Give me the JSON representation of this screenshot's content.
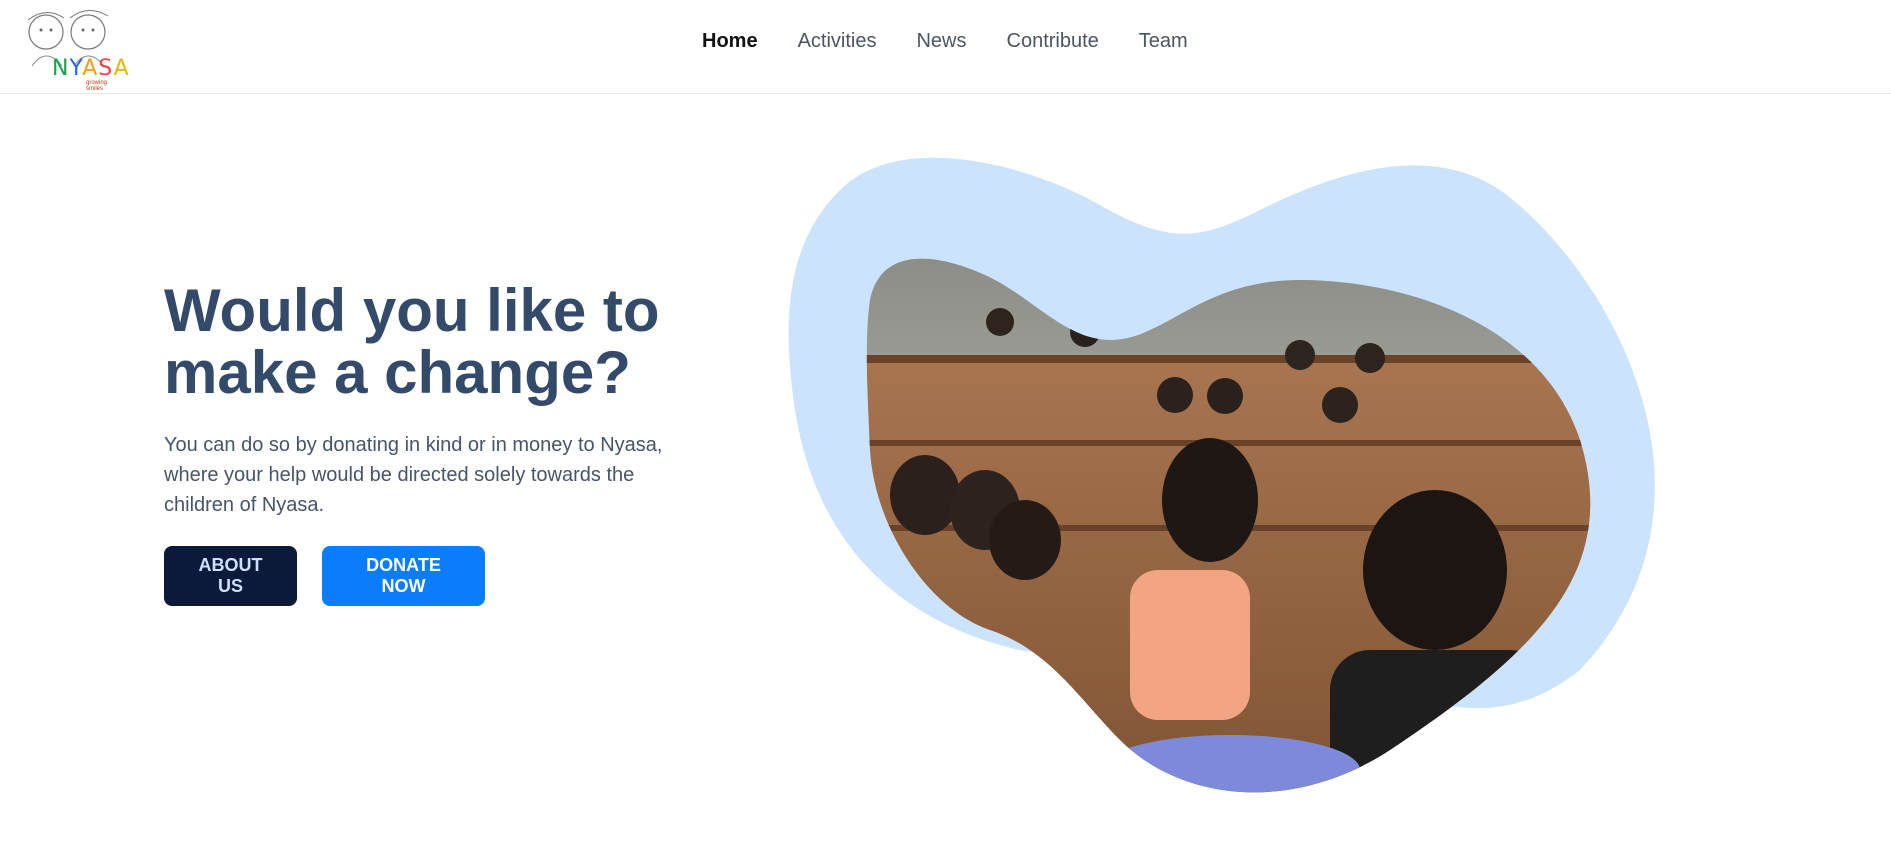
{
  "header": {
    "logo": {
      "letters": [
        "N",
        "Y",
        "A",
        "S",
        "A"
      ],
      "tagline": "growing smiles"
    },
    "nav": [
      {
        "label": "Home",
        "active": true
      },
      {
        "label": "Activities",
        "active": false
      },
      {
        "label": "News",
        "active": false
      },
      {
        "label": "Contribute",
        "active": false
      },
      {
        "label": "Team",
        "active": false
      }
    ]
  },
  "hero": {
    "title": "Would you like to make a change?",
    "description": "You can do so by donating in kind or in money to Nyasa, where your help would be directed solely towards the children of Nyasa.",
    "buttons": {
      "about": "ABOUT US",
      "donate": "DONATE NOW"
    }
  },
  "colors": {
    "blob": "#cce3fd",
    "title": "#334a6b",
    "primary": "#0b7dfb",
    "dark": "#0b1a3a"
  }
}
